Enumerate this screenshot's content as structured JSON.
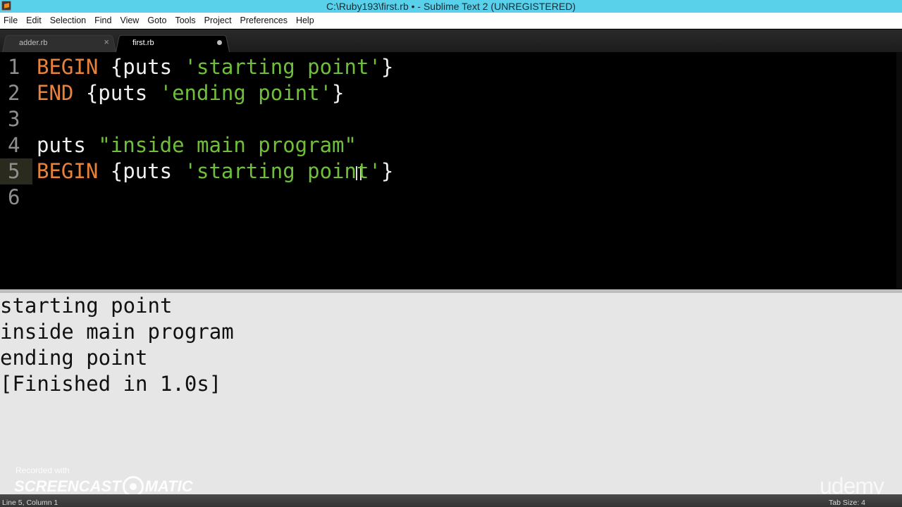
{
  "window": {
    "title": "C:\\Ruby193\\first.rb • - Sublime Text 2 (UNREGISTERED)"
  },
  "menu": [
    "File",
    "Edit",
    "Selection",
    "Find",
    "View",
    "Goto",
    "Tools",
    "Project",
    "Preferences",
    "Help"
  ],
  "tabs": [
    {
      "label": "adder.rb",
      "state": "close",
      "close_glyph": "×"
    },
    {
      "label": "first.rb",
      "state": "modified"
    }
  ],
  "editor": {
    "line_numbers": [
      "1",
      "2",
      "3",
      "4",
      "5",
      "6"
    ],
    "current_line": "5",
    "lines": [
      [
        {
          "t": "BEGIN",
          "c": "kw"
        },
        {
          "t": " {puts ",
          "c": "txt"
        },
        {
          "t": "'starting point'",
          "c": "str"
        },
        {
          "t": "}",
          "c": "txt"
        }
      ],
      [
        {
          "t": "END",
          "c": "kw"
        },
        {
          "t": " {puts ",
          "c": "txt"
        },
        {
          "t": "'ending point'",
          "c": "str"
        },
        {
          "t": "}",
          "c": "txt"
        }
      ],
      [],
      [
        {
          "t": "puts ",
          "c": "txt"
        },
        {
          "t": "\"inside main program\"",
          "c": "str"
        }
      ],
      [
        {
          "t": "BEGIN",
          "c": "kw"
        },
        {
          "t": " {puts ",
          "c": "txt"
        },
        {
          "t": "'starting point'",
          "c": "str"
        },
        {
          "t": "}",
          "c": "txt"
        }
      ],
      []
    ]
  },
  "output": {
    "lines": [
      "starting point",
      "inside main program",
      "ending point",
      "[Finished in 1.0s]"
    ]
  },
  "watermarks": {
    "recorded": "Recorded with",
    "brand_left": "SCREENCAST",
    "brand_right": "MATIC",
    "udemy": "udemy"
  },
  "status": {
    "position": "Line 5, Column 1",
    "tab_size": "Tab Size: 4"
  },
  "colors": {
    "titlebar": "#5ad1ea",
    "keyword": "#e8823a",
    "string": "#6fbf3b",
    "output_bg": "#e6e6e6"
  }
}
